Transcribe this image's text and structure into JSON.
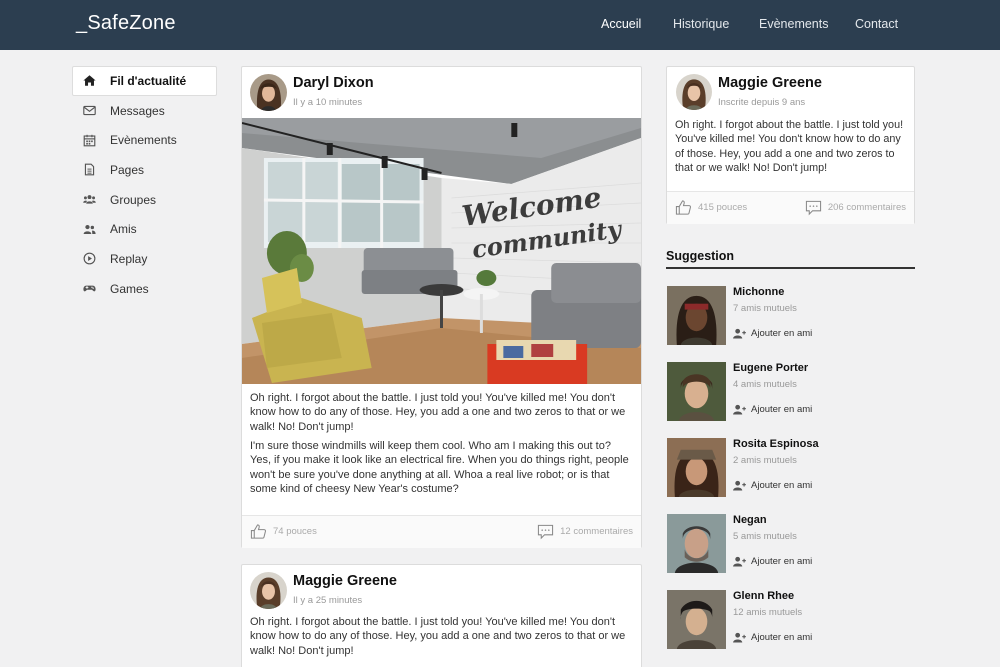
{
  "nav": {
    "brand": "_SafeZone",
    "links": [
      "Accueil",
      "Historique",
      "Evènements",
      "Contact"
    ]
  },
  "sidebar": {
    "items": [
      {
        "label": "Fil d'actualité",
        "icon": "home-icon"
      },
      {
        "label": "Messages",
        "icon": "envelope-icon"
      },
      {
        "label": "Evènements",
        "icon": "calendar-icon"
      },
      {
        "label": "Pages",
        "icon": "page-icon"
      },
      {
        "label": "Groupes",
        "icon": "group-icon"
      },
      {
        "label": "Amis",
        "icon": "friends-icon"
      },
      {
        "label": "Replay",
        "icon": "play-icon"
      },
      {
        "label": "Games",
        "icon": "gamepad-icon"
      }
    ]
  },
  "feed": {
    "posts": [
      {
        "author": "Daryl Dixon",
        "time": "Il y a 10 minutes",
        "image_alt": "Welcome to the community",
        "paragraphs": [
          "Oh right. I forgot about the battle. I just told you! You've killed me! You don't know how to do any of those. Hey, you add a one and two zeros to that or we walk! No! Don't jump!",
          "I'm sure those windmills will keep them cool. Who am I making this out to? Yes, if you make it look like an electrical fire. When you do things right, people won't be sure you've done anything at all. Whoa a real live robot; or is that some kind of cheesy New Year's costume?"
        ],
        "likes": "74 pouces",
        "comments": "12 commentaires"
      },
      {
        "author": "Maggie Greene",
        "time": "Il y a 25 minutes",
        "paragraphs": [
          "Oh right. I forgot about the battle. I just told you! You've killed me! You don't know how to do any of those. Hey, you add a one and two zeros to that or we walk! No! Don't jump!"
        ]
      }
    ]
  },
  "profile": {
    "name": "Maggie Greene",
    "since": "Inscrite depuis 9 ans",
    "text": "Oh right. I forgot about the battle. I just told you! You've killed me! You don't know how to do any of those. Hey, you add a one and two zeros to that or we walk! No! Don't jump!",
    "likes": "415 pouces",
    "comments": "206 commentaires"
  },
  "suggestion": {
    "title": "Suggestion",
    "add_label": "Ajouter en ami",
    "people": [
      {
        "name": "Michonne",
        "mutual": "7 amis mutuels"
      },
      {
        "name": "Eugene Porter",
        "mutual": "4 amis mutuels"
      },
      {
        "name": "Rosita Espinosa",
        "mutual": "2 amis mutuels"
      },
      {
        "name": "Negan",
        "mutual": "5 amis mutuels"
      },
      {
        "name": "Glenn Rhee",
        "mutual": "12 amis mutuels"
      }
    ]
  }
}
